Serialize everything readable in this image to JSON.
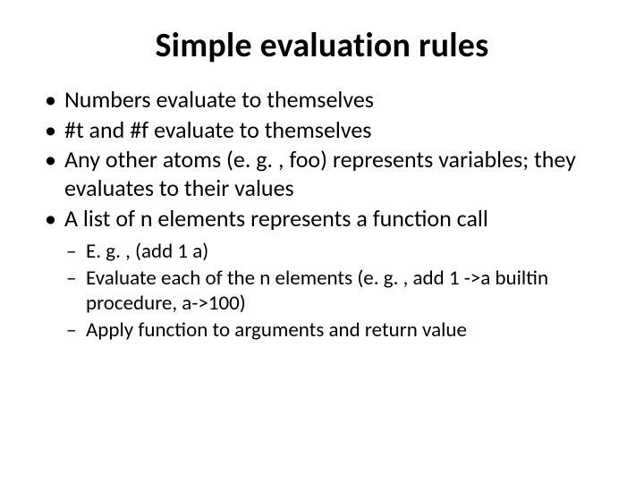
{
  "title": "Simple evaluation rules",
  "bullets": {
    "b0": "Numbers evaluate to themselves",
    "b1": "#t and #f evaluate to themselves",
    "b2": "Any other atoms (e. g. , foo) represents variables; they evaluates to their values",
    "b3": "A list of n elements represents a function call"
  },
  "subbullets": {
    "s0": "E. g. , (add 1 a)",
    "s1": "Evaluate each of the n elements (e. g. , add 1 ->a builtin procedure, a->100)",
    "s2": "Apply function to arguments and return value"
  }
}
